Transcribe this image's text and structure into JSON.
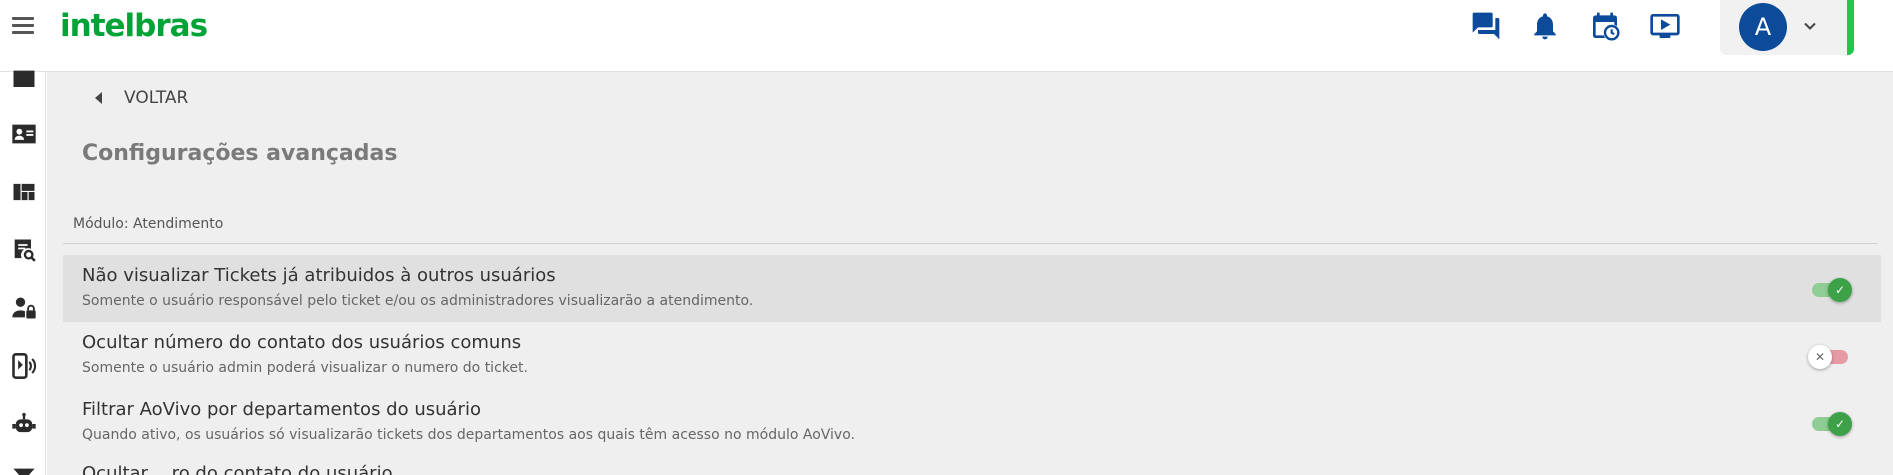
{
  "header": {
    "logo_text": "intelbras",
    "brand_color": "#00a335",
    "icons": [
      "chat-icon",
      "bell-icon",
      "calendar-clock-icon",
      "tv-play-icon"
    ],
    "user": {
      "avatar_initial": "A",
      "avatar_color": "#0c4a9a"
    }
  },
  "sidebar": {
    "icons": [
      "folder-icon",
      "contact-card-icon",
      "dashboard-icon",
      "search-report-icon",
      "user-lock-icon",
      "phone-signal-icon",
      "robot-icon",
      "filter-icon"
    ]
  },
  "main": {
    "back_label": "VOLTAR",
    "title": "Configurações avançadas",
    "module_label": "Módulo: Atendimento",
    "settings": [
      {
        "title": "Não visualizar Tickets já atribuidos à outros usuários",
        "description": "Somente o usuário responsável pelo ticket e/ou os administradores visualizarão a atendimento.",
        "enabled": true
      },
      {
        "title": "Ocultar número do contato dos usuários comuns",
        "description": "Somente o usuário admin poderá visualizar o numero do ticket.",
        "enabled": false
      },
      {
        "title": "Filtrar AoVivo por departamentos do usuário",
        "description": "Quando ativo, os usuários só visualizarão tickets dos departamentos aos quais têm acesso no módulo AoVivo.",
        "enabled": true
      }
    ],
    "partial_next_title": "Ocultar …ro do contato do usuário…"
  },
  "colors": {
    "toggle_on": "#3da247",
    "toggle_off": "#e69aa3",
    "accent": "#1ec84a"
  }
}
